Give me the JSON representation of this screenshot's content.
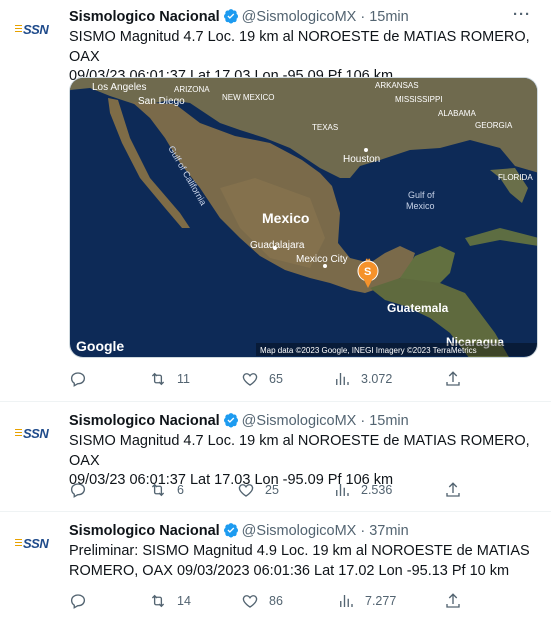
{
  "tweets": [
    {
      "name": "Sismologico Nacional",
      "handle": "@SismologicoMX",
      "separator": "·",
      "time": "15min",
      "avatar_text": "SSN",
      "text": "SISMO Magnitud 4.7 Loc.  19 km al NOROESTE de MATIAS ROMERO, OAX\n09/03/23 06:01:37 Lat 17.03 Lon -95.09 Pf 106 km",
      "more": "···",
      "map": {
        "labels": {
          "los_angeles": "Los Angeles",
          "san_diego": "San Diego",
          "arizona": "ARIZONA",
          "new_mexico": "NEW MEXICO",
          "arkansas": "ARKANSAS",
          "mississippi": "MISSISSIPPI",
          "alabama": "ALABAMA",
          "georgia": "GEORGIA",
          "texas": "TEXAS",
          "houston": "Houston",
          "florida": "FLORIDA",
          "gulf_california": "Gulf of California",
          "gulf_mexico_1": "Gulf of",
          "gulf_mexico_2": "Mexico",
          "mexico": "Mexico",
          "guadalajara": "Guadalajara",
          "mexico_city": "Mexico City",
          "guatemala": "Guatemala",
          "nicaragua": "Nicaragua",
          "marker": "S",
          "google": "Google",
          "attribution": "Map data ©2023 Google, INEGI Imagery ©2023 TerraMetrics"
        },
        "colors": {
          "sea": "#0d2a57",
          "land": "#7a6a4a",
          "marker": "#f5922b"
        }
      },
      "actions": {
        "replies": "",
        "retweets": "11",
        "likes": "65",
        "views": "3.072"
      }
    },
    {
      "name": "Sismologico Nacional",
      "handle": "@SismologicoMX",
      "separator": "·",
      "time": "15min",
      "avatar_text": "SSN",
      "text": "SISMO Magnitud 4.7 Loc. 19 km al NOROESTE de MATIAS ROMERO, OAX\n09/03/23 06:01:37 Lat 17.03 Lon -95.09 Pf 106 km",
      "more": "···",
      "actions": {
        "replies": "",
        "retweets": "6",
        "likes": "25",
        "views": "2.536"
      }
    },
    {
      "name": "Sismologico Nacional",
      "handle": "@SismologicoMX",
      "separator": "·",
      "time": "37min",
      "avatar_text": "SSN",
      "text": "Preliminar: SISMO Magnitud 4.9 Loc. 19 km al NOROESTE de MATIAS\nROMERO, OAX 09/03/2023 06:01:36 Lat 17.02 Lon -95.13 Pf 10 km",
      "more": "···",
      "actions": {
        "replies": "",
        "retweets": "14",
        "likes": "86",
        "views": "7.277"
      }
    }
  ],
  "colors": {
    "verified": "#1d9bf0",
    "text_secondary": "#536471",
    "divider": "#eff3f4"
  }
}
